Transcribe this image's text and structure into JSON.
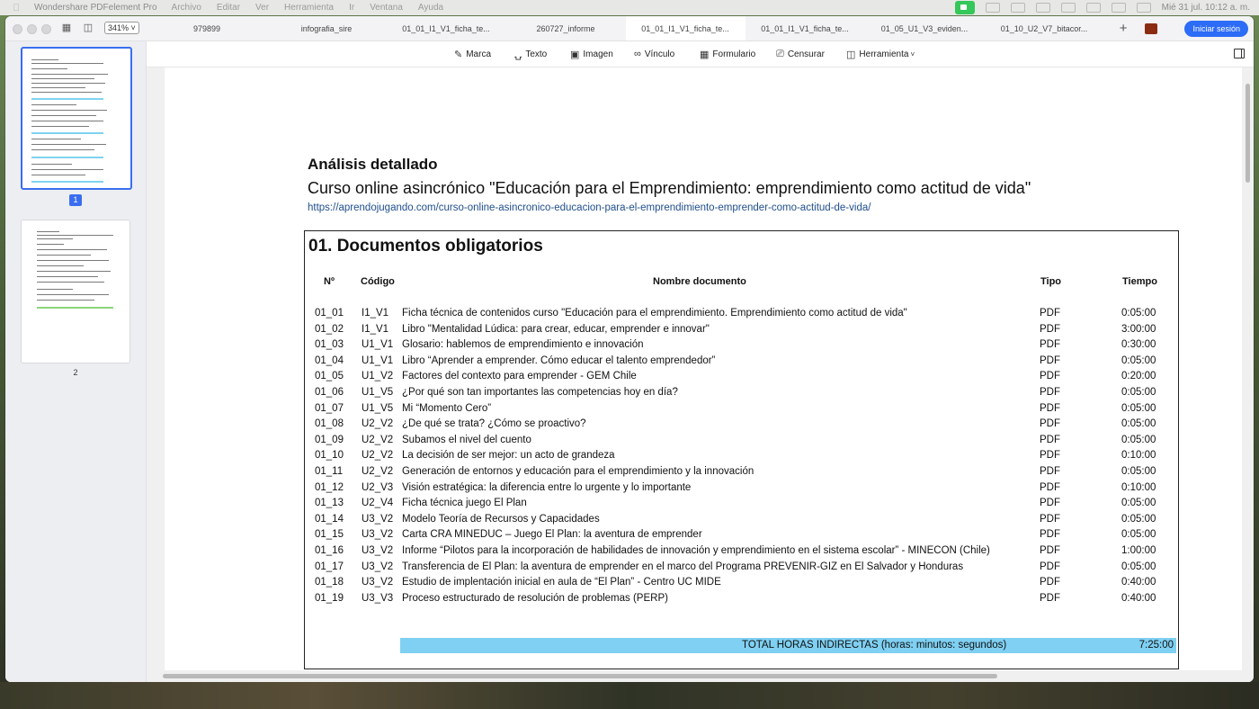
{
  "menubar": {
    "app_name": "Wondershare PDFelement Pro",
    "items": [
      "Archivo",
      "Editar",
      "Ver",
      "Herramienta",
      "Ir",
      "Ventana",
      "Ayuda"
    ],
    "clock": "Mié 31 jul.  10:12 a. m."
  },
  "titlebar": {
    "zoom": "341%",
    "tabs": [
      {
        "label": "979899"
      },
      {
        "label": "infografia_sire"
      },
      {
        "label": "01_01_I1_V1_ficha_te..."
      },
      {
        "label": "260727_informe"
      },
      {
        "label": "01_01_I1_V1_ficha_te..."
      },
      {
        "label": "01_01_I1_V1_ficha_te..."
      },
      {
        "label": "01_05_U1_V3_eviden..."
      },
      {
        "label": "01_10_U2_V7_bitacor..."
      }
    ],
    "active_tab_index": 4,
    "plus": "+",
    "login_label": "Iniciar sesión"
  },
  "sidebar": {
    "page1_label": "1",
    "page2_label": "2"
  },
  "edit_toolbar": {
    "marca": "Marca",
    "texto": "Texto",
    "imagen": "Imagen",
    "vinculo": "Vínculo",
    "formulario": "Formulario",
    "censurar": "Censurar",
    "herramienta": "Herramienta"
  },
  "document": {
    "heading": "Análisis detallado",
    "course": "Curso online asincrónico \"Educación para el Emprendimiento: emprendimiento como actitud de vida\"",
    "url": "https://aprendojugando.com/curso-online-asincronico-educacion-para-el-emprendimiento-emprender-como-actitud-de-vida/",
    "section_title": "01. Documentos obligatorios",
    "columns": {
      "no": "Nº",
      "codigo": "Código",
      "nombre": "Nombre documento",
      "tipo": "Tipo",
      "tiempo": "Tiempo"
    },
    "rows": [
      {
        "no": "01_01",
        "codigo": "I1_V1",
        "nombre": "Ficha técnica de contenidos curso \"Educación para el emprendimiento. Emprendimiento como actitud de vida\"",
        "tipo": "PDF",
        "tiempo": "0:05:00"
      },
      {
        "no": "01_02",
        "codigo": "I1_V1",
        "nombre": "Libro \"Mentalidad Lúdica: para crear, educar, emprender e innovar\"",
        "tipo": "PDF",
        "tiempo": "3:00:00"
      },
      {
        "no": "01_03",
        "codigo": "U1_V1",
        "nombre": "Glosario: hablemos de emprendimiento e innovación",
        "tipo": "PDF",
        "tiempo": "0:30:00"
      },
      {
        "no": "01_04",
        "codigo": "U1_V1",
        "nombre": "Libro “Aprender a emprender. Cómo educar el talento emprendedor”",
        "tipo": "PDF",
        "tiempo": "0:05:00"
      },
      {
        "no": "01_05",
        "codigo": "U1_V2",
        "nombre": "Factores del contexto para emprender - GEM Chile",
        "tipo": "PDF",
        "tiempo": "0:20:00"
      },
      {
        "no": "01_06",
        "codigo": "U1_V5",
        "nombre": "¿Por qué son tan importantes las competencias hoy en día?",
        "tipo": "PDF",
        "tiempo": "0:05:00"
      },
      {
        "no": "01_07",
        "codigo": "U1_V5",
        "nombre": "Mi “Momento Cero”",
        "tipo": "PDF",
        "tiempo": "0:05:00"
      },
      {
        "no": "01_08",
        "codigo": "U2_V2",
        "nombre": "¿De qué se trata? ¿Cómo se proactivo?",
        "tipo": "PDF",
        "tiempo": "0:05:00"
      },
      {
        "no": "01_09",
        "codigo": "U2_V2",
        "nombre": "Subamos el nivel del cuento",
        "tipo": "PDF",
        "tiempo": "0:05:00"
      },
      {
        "no": "01_10",
        "codigo": "U2_V2",
        "nombre": "La decisión de ser mejor: un acto de grandeza",
        "tipo": "PDF",
        "tiempo": "0:10:00"
      },
      {
        "no": "01_11",
        "codigo": "U2_V2",
        "nombre": "Generación de entornos y educación para el emprendimiento y la innovación",
        "tipo": "PDF",
        "tiempo": "0:05:00"
      },
      {
        "no": "01_12",
        "codigo": "U2_V3",
        "nombre": "Visión estratégica: la diferencia entre lo urgente y lo importante",
        "tipo": "PDF",
        "tiempo": "0:10:00"
      },
      {
        "no": "01_13",
        "codigo": "U2_V4",
        "nombre": "Ficha técnica juego El Plan",
        "tipo": "PDF",
        "tiempo": "0:05:00"
      },
      {
        "no": "01_14",
        "codigo": "U3_V2",
        "nombre": "Modelo Teoría de Recursos y Capacidades",
        "tipo": "PDF",
        "tiempo": "0:05:00"
      },
      {
        "no": "01_15",
        "codigo": "U3_V2",
        "nombre": "Carta CRA MINEDUC – Juego El Plan: la aventura de emprender",
        "tipo": "PDF",
        "tiempo": "0:05:00"
      },
      {
        "no": "01_16",
        "codigo": "U3_V2",
        "nombre": "Informe “Pilotos para la incorporación de habilidades de innovación y emprendimiento en el sistema escolar” - MINECON (Chile)",
        "tipo": "PDF",
        "tiempo": "1:00:00"
      },
      {
        "no": "01_17",
        "codigo": "U3_V2",
        "nombre": "Transferencia de El Plan: la aventura de emprender en el marco del Programa PREVENIR-GIZ en El Salvador y Honduras",
        "tipo": "PDF",
        "tiempo": "0:05:00"
      },
      {
        "no": "01_18",
        "codigo": "U3_V2",
        "nombre": "Estudio de implentación inicial en aula de “El Plan” - Centro UC MIDE",
        "tipo": "PDF",
        "tiempo": "0:40:00"
      },
      {
        "no": "01_19",
        "codigo": "U3_V3",
        "nombre": "Proceso estructurado de resolución de problemas (PERP)",
        "tipo": "PDF",
        "tiempo": "0:40:00"
      }
    ],
    "total_label": "TOTAL HORAS INDIRECTAS (horas: minutos: segundos)",
    "total_value": "7:25:00"
  },
  "colors": {
    "accent": "#2c6cf6",
    "total_bar": "#7fd0f2",
    "url": "#1f4e8c"
  }
}
